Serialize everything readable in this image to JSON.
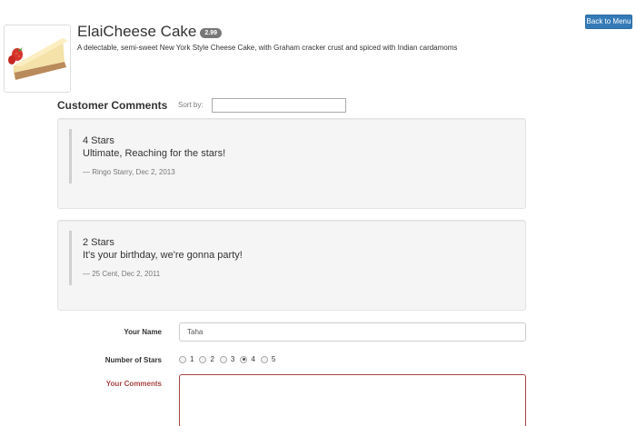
{
  "header": {
    "back_button_label": "Back to Menu"
  },
  "dish": {
    "name": "ElaiCheese Cake",
    "price": "2.99",
    "description": "A delectable, semi-sweet New York Style Cheese Cake, with Graham cracker crust and spiced with Indian cardamoms",
    "image_icon": "cheesecake-image"
  },
  "comments_section": {
    "heading": "Customer Comments",
    "sort_label": "Sort by:",
    "sort_value": "",
    "comments": [
      {
        "stars_text": "4 Stars",
        "comment": "Ultimate, Reaching for the stars!",
        "footer": "— Ringo Starry, Dec 2, 2013"
      },
      {
        "stars_text": "2 Stars",
        "comment": "It's your birthday, we're gonna party!",
        "footer": "— 25 Cent, Dec 2, 2011"
      }
    ]
  },
  "form": {
    "name_label": "Your Name",
    "name_value": "Taha",
    "stars_label": "Number of Stars",
    "star_options": [
      "1",
      "2",
      "3",
      "4",
      "5"
    ],
    "selected_stars": "4",
    "comments_label": "Your Comments",
    "comments_value": ""
  },
  "colors": {
    "primary": "#337ab7",
    "error": "#a94442",
    "badge": "#777777",
    "well": "#f5f5f5"
  }
}
